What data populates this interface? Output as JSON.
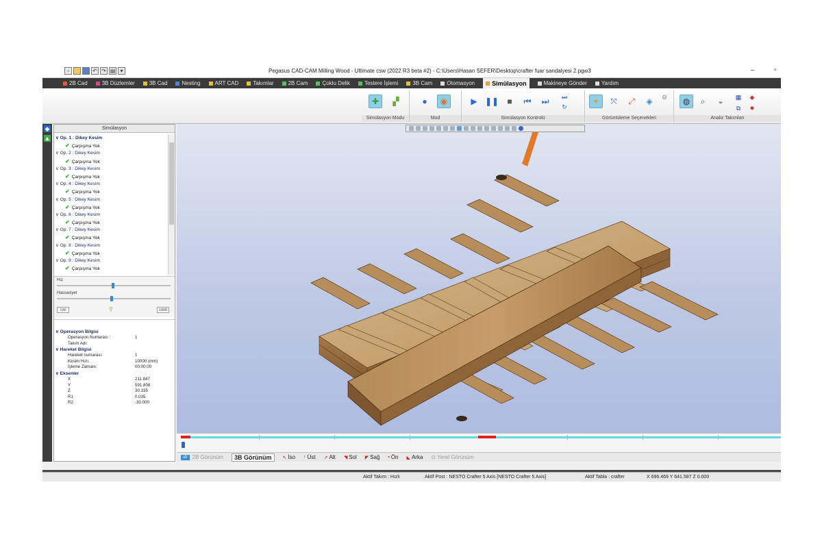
{
  "app": {
    "title": "Pegasus CAD-CAM Milling Wood - Ultimate csw (2022 R3 beta #2) - C:\\Users\\Hasan SEFER\\Desktop\\crafter fuar sandalyesi 2.pgw3"
  },
  "menu": [
    {
      "label": "2B Cad",
      "color": "#e05a3a"
    },
    {
      "label": "3B Düzlemler",
      "color": "#d24a8a"
    },
    {
      "label": "3B Cad",
      "color": "#e8b83a"
    },
    {
      "label": "Nesting",
      "color": "#4a8ad2"
    },
    {
      "label": "ART CAD",
      "color": "#e8c03a"
    },
    {
      "label": "Takımlar",
      "color": "#e8c03a"
    },
    {
      "label": "2B Cam",
      "color": "#5ac05a"
    },
    {
      "label": "Çoklu Delik",
      "color": "#5ac05a"
    },
    {
      "label": "Testere İşlemi",
      "color": "#5ac05a"
    },
    {
      "label": "3B Cam",
      "color": "#e8c03a"
    },
    {
      "label": "Otomasyon",
      "color": "#dddddd"
    },
    {
      "label": "Simülasyon",
      "color": "#e8a03a",
      "active": true
    },
    {
      "label": "Makineye Gönder",
      "color": "#dddddd"
    },
    {
      "label": "Yardım",
      "color": "#dddddd"
    }
  ],
  "ribbon": {
    "groups": [
      "Simülasyon Modu",
      "Mod",
      "Simülasyon Kontrolü",
      "Görüntüleme Seçenekleri",
      "Analiz Takımları"
    ]
  },
  "panel": {
    "title": "Simülasyon",
    "operations": [
      {
        "label": "Op. 1 : Dikey Kesim",
        "status": "Çarpışma Yok"
      },
      {
        "label": "Op. 2 : Dikey Kesim",
        "status": "Çarpışma Yok"
      },
      {
        "label": "Op. 3 : Dikey Kesim",
        "status": "Çarpışma Yok"
      },
      {
        "label": "Op. 4 : Dikey Kesim",
        "status": "Çarpışma Yok"
      },
      {
        "label": "Op. 5 : Dikey Kesim",
        "status": "Çarpışma Yok"
      },
      {
        "label": "Op. 6 : Dikey Kesim",
        "status": "Çarpışma Yok"
      },
      {
        "label": "Op. 7 : Dikey Kesim",
        "status": "Çarpışma Yok"
      },
      {
        "label": "Op. 8 : Dikey Kesim",
        "status": "Çarpışma Yok"
      },
      {
        "label": "Op. 9 : Dikey Kesim",
        "status": "Çarpışma Yok"
      }
    ],
    "speed_label": "Hız",
    "precision_label": "Hassasiyet",
    "min_box": "100",
    "max_box": "1000"
  },
  "info": {
    "op_section": "Operasyon Bilgisi",
    "op_rows": [
      {
        "k": "Operasyon Numarası :",
        "v": "1"
      },
      {
        "k": "Takım Adı:",
        "v": ""
      }
    ],
    "move_section": "Hareket Bilgisi",
    "move_rows": [
      {
        "k": "Hareket numarası:",
        "v": "1"
      },
      {
        "k": "Kesim Hızı:",
        "v": "10000 (mm)"
      },
      {
        "k": "İşleme Zamanı:",
        "v": "00:00:00"
      }
    ],
    "axes_section": "Eksenler",
    "axes_rows": [
      {
        "k": "X",
        "v": "211.847"
      },
      {
        "k": "Y",
        "v": "591.808"
      },
      {
        "k": "Z",
        "v": "30.335"
      },
      {
        "k": "R1",
        "v": "0.035"
      },
      {
        "k": "R2",
        "v": "-30.000"
      }
    ]
  },
  "viewtabs": {
    "badge": "sfr",
    "tab_2d": "2B Görünüm",
    "tab_3d": "3B Görünüm",
    "iso": "İso",
    "top": "Üst",
    "bottom": "Alt",
    "left": "Sol",
    "right": "Sağ",
    "front": "Ön",
    "back": "Arka",
    "local": "Yerel Görünüm"
  },
  "status": {
    "tool": "Aktif Takım : Hızlı",
    "post": "Aktif Post : NESTO Crafter 5 Axis [NESTO Crafter 5 Axis]",
    "table": "Aktif Tabla : crafter",
    "coords": "X 696.469  Y 641.587  Z 0.000"
  },
  "timeline": {
    "progress": 0.01
  }
}
